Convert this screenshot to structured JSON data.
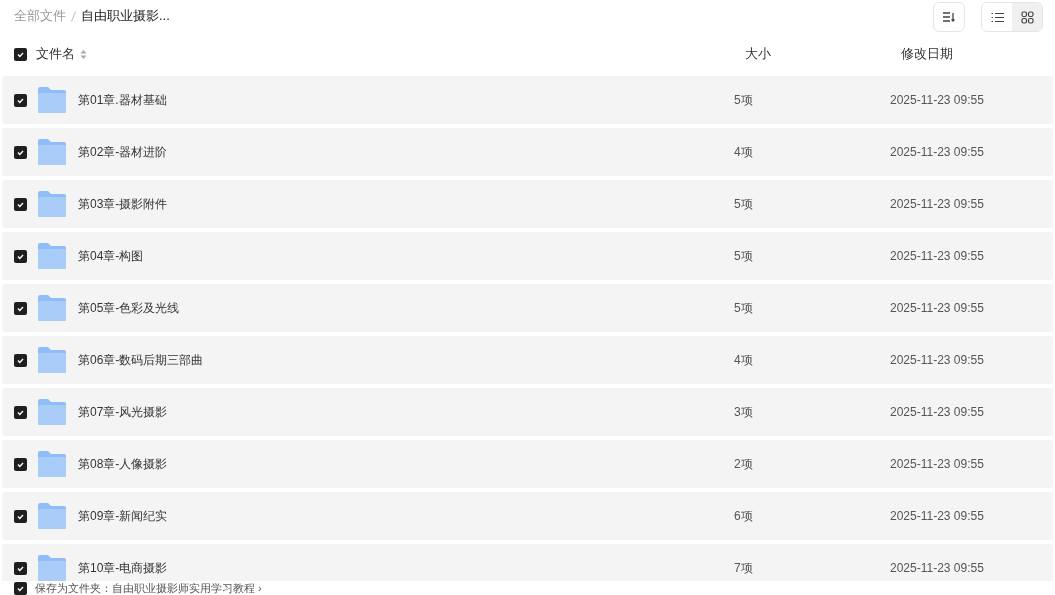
{
  "breadcrumb": [
    {
      "label": "全部文件",
      "selected": false
    },
    {
      "label": "自由职业摄影...",
      "selected": true
    }
  ],
  "toolbar": {
    "view_modes": [
      {
        "kind": "list",
        "selected": false
      },
      {
        "kind": "grid",
        "selected": true
      }
    ]
  },
  "table": {
    "all_checked": true,
    "columns": [
      "文件名",
      "大小",
      "修改日期"
    ],
    "rows": [
      {
        "name": "第01章.器材基础",
        "size": "5项",
        "modified": "2025-11-23 09:55",
        "checked": true
      },
      {
        "name": "第02章-器材进阶",
        "size": "4项",
        "modified": "2025-11-23 09:55",
        "checked": true
      },
      {
        "name": "第03章-摄影附件",
        "size": "5项",
        "modified": "2025-11-23 09:55",
        "checked": true
      },
      {
        "name": "第04章-构图",
        "size": "5项",
        "modified": "2025-11-23 09:55",
        "checked": true
      },
      {
        "name": "第05章-色彩及光线",
        "size": "5项",
        "modified": "2025-11-23 09:55",
        "checked": true
      },
      {
        "name": "第06章-数码后期三部曲",
        "size": "4项",
        "modified": "2025-11-23 09:55",
        "checked": true
      },
      {
        "name": "第07章-风光摄影",
        "size": "3项",
        "modified": "2025-11-23 09:55",
        "checked": true
      },
      {
        "name": "第08章-人像摄影",
        "size": "2项",
        "modified": "2025-11-23 09:55",
        "checked": true
      },
      {
        "name": "第09章-新闻纪实",
        "size": "6项",
        "modified": "2025-11-23 09:55",
        "checked": true
      },
      {
        "name": "第10章-电商摄影",
        "size": "7项",
        "modified": "2025-11-23 09:55",
        "checked": true
      }
    ]
  },
  "footer": {
    "checked": true,
    "text": "保存为文件夹：自由职业摄影师实用学习教程 ›"
  }
}
